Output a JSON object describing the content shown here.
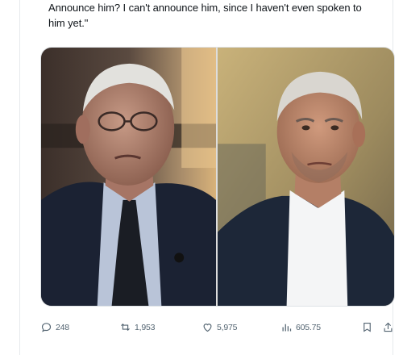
{
  "tweet": {
    "text_line_1": "Announce him? I can't announce him, since I haven't even spoken to",
    "text_line_2": "him yet.\""
  },
  "actions": {
    "reply": {
      "icon": "reply-icon",
      "count": "248"
    },
    "retweet": {
      "icon": "retweet-icon",
      "count": "1,953"
    },
    "like": {
      "icon": "heart-icon",
      "count": "5,975"
    },
    "views": {
      "icon": "views-icon",
      "count": "605.75"
    },
    "bookmark": {
      "icon": "bookmark-icon"
    },
    "share": {
      "icon": "share-icon"
    }
  },
  "colors": {
    "action_gray": "#536471",
    "border": "#e6e9ec"
  }
}
